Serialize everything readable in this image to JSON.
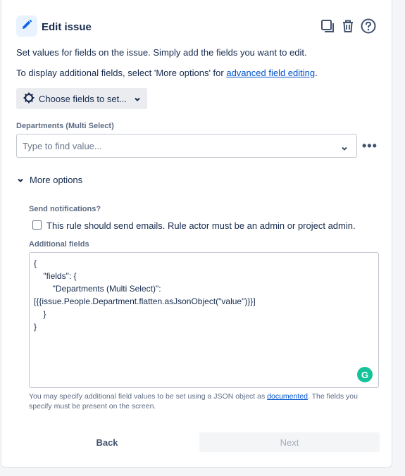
{
  "header": {
    "title": "Edit issue",
    "icons": [
      "pencil-icon",
      "copy-icon",
      "trash-icon",
      "help-icon"
    ]
  },
  "intro": {
    "line1": "Set values for fields on the issue. Simply add the fields you want to edit.",
    "line2_prefix": "To display additional fields, select 'More options' for ",
    "line2_link": "advanced field editing",
    "line2_suffix": "."
  },
  "choose_fields": {
    "label": "Choose fields to set..."
  },
  "departments": {
    "label": "Departments (Multi Select)",
    "placeholder": "Type to find value..."
  },
  "more_options": {
    "label": "More options",
    "send_notifications_label": "Send notifications?",
    "checkbox_label": "This rule should send emails. Rule actor must be an admin or project admin.",
    "checkbox_checked": false,
    "additional_fields_label": "Additional fields",
    "additional_fields_lines": [
      "{",
      "    \"fields\": {",
      "        \"Departments (Multi Select)\":",
      "[{{issue.People.Department.flatten.asJsonObject(\"value\")}}]",
      "    }",
      "}"
    ],
    "grammarly_letter": "G",
    "help_prefix": "You may specify additional field values to be set using a JSON object as ",
    "help_link": "documented",
    "help_suffix": ". The fields you specify must be present on the screen."
  },
  "footer": {
    "back_label": "Back",
    "next_label": "Next"
  },
  "colors": {
    "accent": "#0052cc",
    "badge_bg": "#e9f2ff",
    "grammarly": "#15c39a"
  }
}
